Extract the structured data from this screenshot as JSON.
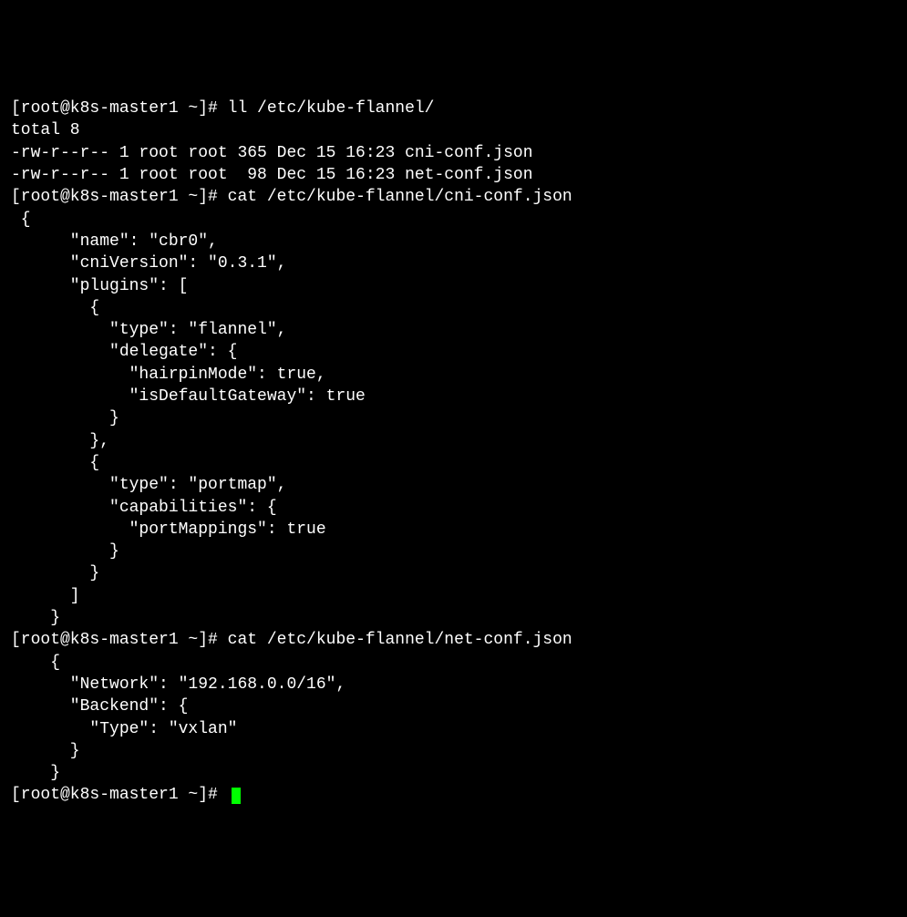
{
  "prompt1": "[root@k8s-master1 ~]# ",
  "cmd1": "ll /etc/kube-flannel/",
  "out1": {
    "total": "total 8",
    "line1": "-rw-r--r-- 1 root root 365 Dec 15 16:23 cni-conf.json",
    "line2": "-rw-r--r-- 1 root root  98 Dec 15 16:23 net-conf.json"
  },
  "prompt2": "[root@k8s-master1 ~]# ",
  "cmd2": "cat /etc/kube-flannel/cni-conf.json",
  "cni": {
    "l1": " {",
    "l2": "      \"name\": \"cbr0\",",
    "l3": "      \"cniVersion\": \"0.3.1\",",
    "l4": "      \"plugins\": [",
    "l5": "        {",
    "l6": "          \"type\": \"flannel\",",
    "l7": "          \"delegate\": {",
    "l8": "            \"hairpinMode\": true,",
    "l9": "            \"isDefaultGateway\": true",
    "l10": "          }",
    "l11": "        },",
    "l12": "        {",
    "l13": "          \"type\": \"portmap\",",
    "l14": "          \"capabilities\": {",
    "l15": "            \"portMappings\": true",
    "l16": "          }",
    "l17": "        }",
    "l18": "      ]",
    "l19": "    }"
  },
  "prompt3": "[root@k8s-master1 ~]# ",
  "cmd3": "cat /etc/kube-flannel/net-conf.json",
  "net": {
    "l1": "    {",
    "l2": "      \"Network\": \"192.168.0.0/16\",",
    "l3": "      \"Backend\": {",
    "l4": "        \"Type\": \"vxlan\"",
    "l5": "      }",
    "l6": "    }"
  },
  "prompt4": "[root@k8s-master1 ~]# "
}
